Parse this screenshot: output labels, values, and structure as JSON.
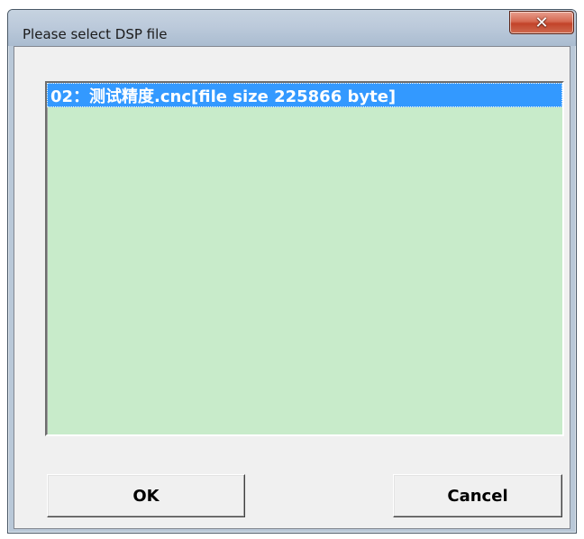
{
  "dialog": {
    "title": "Please select DSP file",
    "close_icon": "close-icon"
  },
  "file_list": {
    "items": [
      {
        "label": "02：测试精度.cnc[file size 225866 byte]",
        "selected": true
      }
    ]
  },
  "buttons": {
    "ok_label": "OK",
    "cancel_label": "Cancel"
  },
  "colors": {
    "list_background": "#c8ebca",
    "selection": "#3399ff",
    "close_button": "#c2432a"
  }
}
